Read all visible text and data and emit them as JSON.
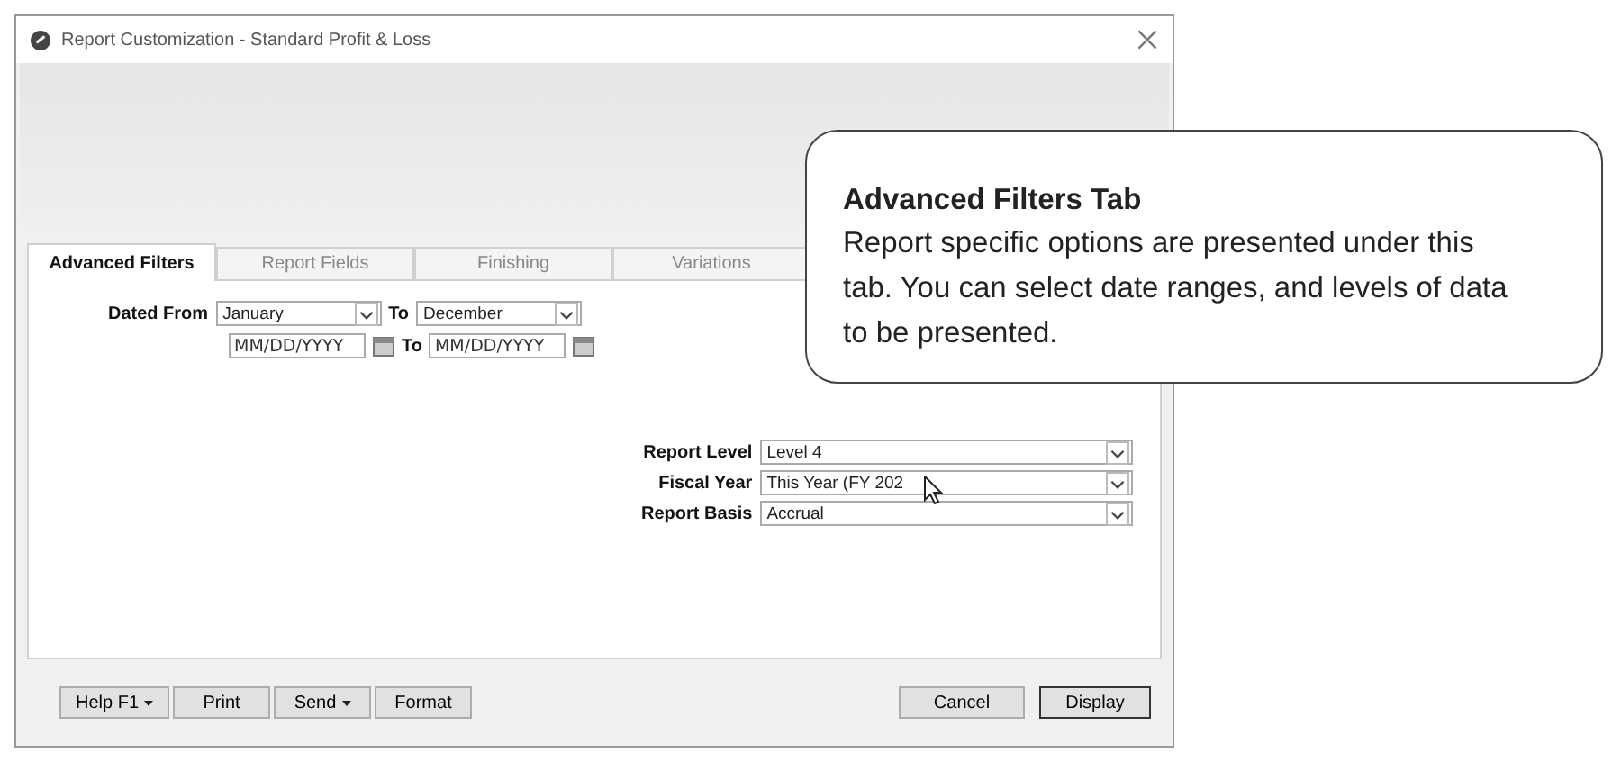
{
  "window": {
    "title": "Report Customization - Standard Profit & Loss"
  },
  "tabs": [
    {
      "label": "Advanced Filters",
      "selected": true
    },
    {
      "label": "Report Fields",
      "selected": false
    },
    {
      "label": "Finishing",
      "selected": false
    },
    {
      "label": "Variations",
      "selected": false
    }
  ],
  "date_range": {
    "label": "Dated From",
    "from_month": "January",
    "to_label": "To",
    "to_month": "December",
    "from_date_placeholder": "MM/DD/YYYY",
    "to_date_label": "To",
    "to_date_placeholder": "MM/DD/YYYY"
  },
  "options": [
    {
      "label": "Report Level",
      "value": "Level 4"
    },
    {
      "label": "Fiscal Year",
      "value": "This Year (FY 202"
    },
    {
      "label": "Report Basis",
      "value": "Accrual"
    }
  ],
  "buttons_left": [
    {
      "label": "Help F1",
      "dropdown": true
    },
    {
      "label": "Print",
      "dropdown": false
    },
    {
      "label": "Send",
      "dropdown": true
    },
    {
      "label": "Format",
      "dropdown": false
    }
  ],
  "buttons_right": [
    {
      "label": "Cancel",
      "default": false
    },
    {
      "label": "Display",
      "default": true
    }
  ],
  "callout": {
    "title": "Advanced Filters Tab",
    "body": "Report specific options are presented under this tab. You can select date ranges, and levels of data to be presented."
  }
}
